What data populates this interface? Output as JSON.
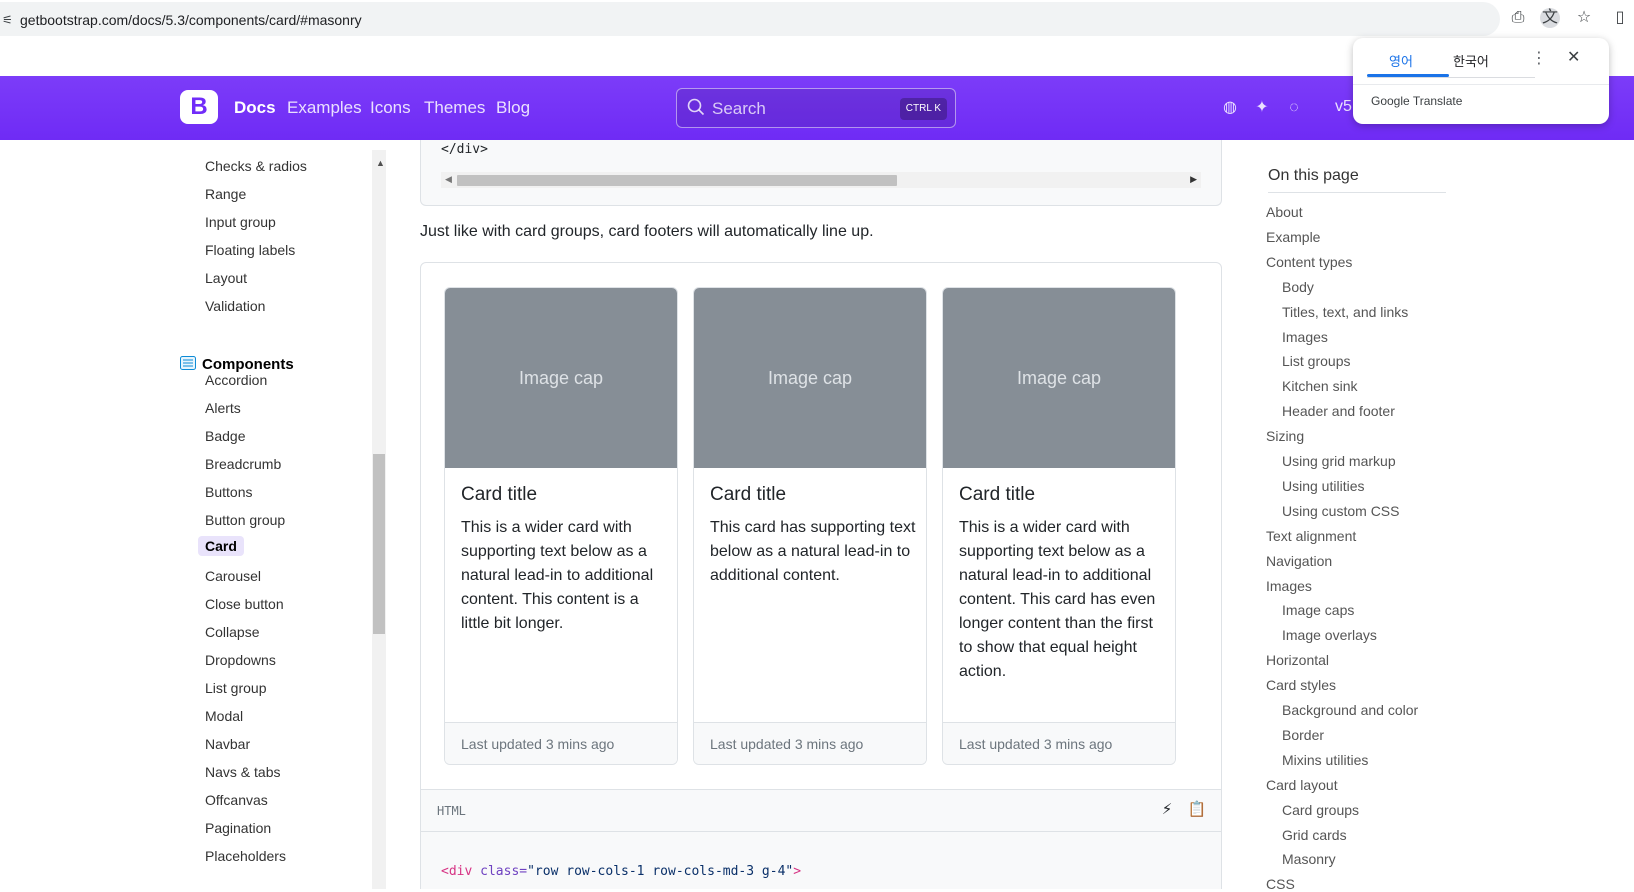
{
  "browser": {
    "url": "getbootstrap.com/docs/5.3/components/card/#masonry",
    "icons": [
      "tune-icon",
      "install-icon",
      "translate-icon",
      "bookmark-star-icon",
      "sidebar-icon"
    ]
  },
  "navbar": {
    "brand": "B",
    "links": [
      "Docs",
      "Examples",
      "Icons",
      "Themes",
      "Blog"
    ],
    "active_link": "Docs",
    "search_placeholder": "Search",
    "search_kbd": "CTRL K",
    "version": "v5",
    "accent": "#712cf9"
  },
  "translate_popup": {
    "tab_source": "영어",
    "tab_target": "한국어",
    "brand": "Google Translate"
  },
  "sidebar": {
    "items_top": [
      "Checks & radios",
      "Range",
      "Input group",
      "Floating labels",
      "Layout",
      "Validation"
    ],
    "section_title": "Components",
    "items": [
      "Accordion",
      "Alerts",
      "Badge",
      "Breadcrumb",
      "Buttons",
      "Button group",
      "Card",
      "Carousel",
      "Close button",
      "Collapse",
      "Dropdowns",
      "List group",
      "Modal",
      "Navbar",
      "Navs & tabs",
      "Offcanvas",
      "Pagination",
      "Placeholders"
    ],
    "active": "Card"
  },
  "main": {
    "code_top_line": "</div>",
    "paragraph": "Just like with card groups, card footers will automatically line up.",
    "cards": [
      {
        "image": "Image cap",
        "title": "Card title",
        "text": "This is a wider card with supporting text below as a natural lead-in to additional content. This content is a little bit longer.",
        "footer": "Last updated 3 mins ago"
      },
      {
        "image": "Image cap",
        "title": "Card title",
        "text": "This card has supporting text below as a natural lead-in to additional content.",
        "footer": "Last updated 3 mins ago"
      },
      {
        "image": "Image cap",
        "title": "Card title",
        "text": "This is a wider card with supporting text below as a natural lead-in to additional content. This card has even longer content than the first to show that equal height action.",
        "footer": "Last updated 3 mins ago"
      }
    ],
    "code_lang": "HTML",
    "code_line_tag": "<div",
    "code_line_attr": " class=",
    "code_line_val": "\"row row-cols-1 row-cols-md-3 g-4\"",
    "code_line_end": ">"
  },
  "toc": {
    "title": "On this page",
    "items": [
      {
        "label": "About",
        "level": 1
      },
      {
        "label": "Example",
        "level": 1
      },
      {
        "label": "Content types",
        "level": 1
      },
      {
        "label": "Body",
        "level": 2
      },
      {
        "label": "Titles, text, and links",
        "level": 2
      },
      {
        "label": "Images",
        "level": 2
      },
      {
        "label": "List groups",
        "level": 2
      },
      {
        "label": "Kitchen sink",
        "level": 2
      },
      {
        "label": "Header and footer",
        "level": 2
      },
      {
        "label": "Sizing",
        "level": 1
      },
      {
        "label": "Using grid markup",
        "level": 2
      },
      {
        "label": "Using utilities",
        "level": 2
      },
      {
        "label": "Using custom CSS",
        "level": 2
      },
      {
        "label": "Text alignment",
        "level": 1
      },
      {
        "label": "Navigation",
        "level": 1
      },
      {
        "label": "Images",
        "level": 1
      },
      {
        "label": "Image caps",
        "level": 2
      },
      {
        "label": "Image overlays",
        "level": 2
      },
      {
        "label": "Horizontal",
        "level": 1
      },
      {
        "label": "Card styles",
        "level": 1
      },
      {
        "label": "Background and color",
        "level": 2
      },
      {
        "label": "Border",
        "level": 2
      },
      {
        "label": "Mixins utilities",
        "level": 2
      },
      {
        "label": "Card layout",
        "level": 1
      },
      {
        "label": "Card groups",
        "level": 2
      },
      {
        "label": "Grid cards",
        "level": 2
      },
      {
        "label": "Masonry",
        "level": 2
      },
      {
        "label": "CSS",
        "level": 1
      }
    ]
  }
}
